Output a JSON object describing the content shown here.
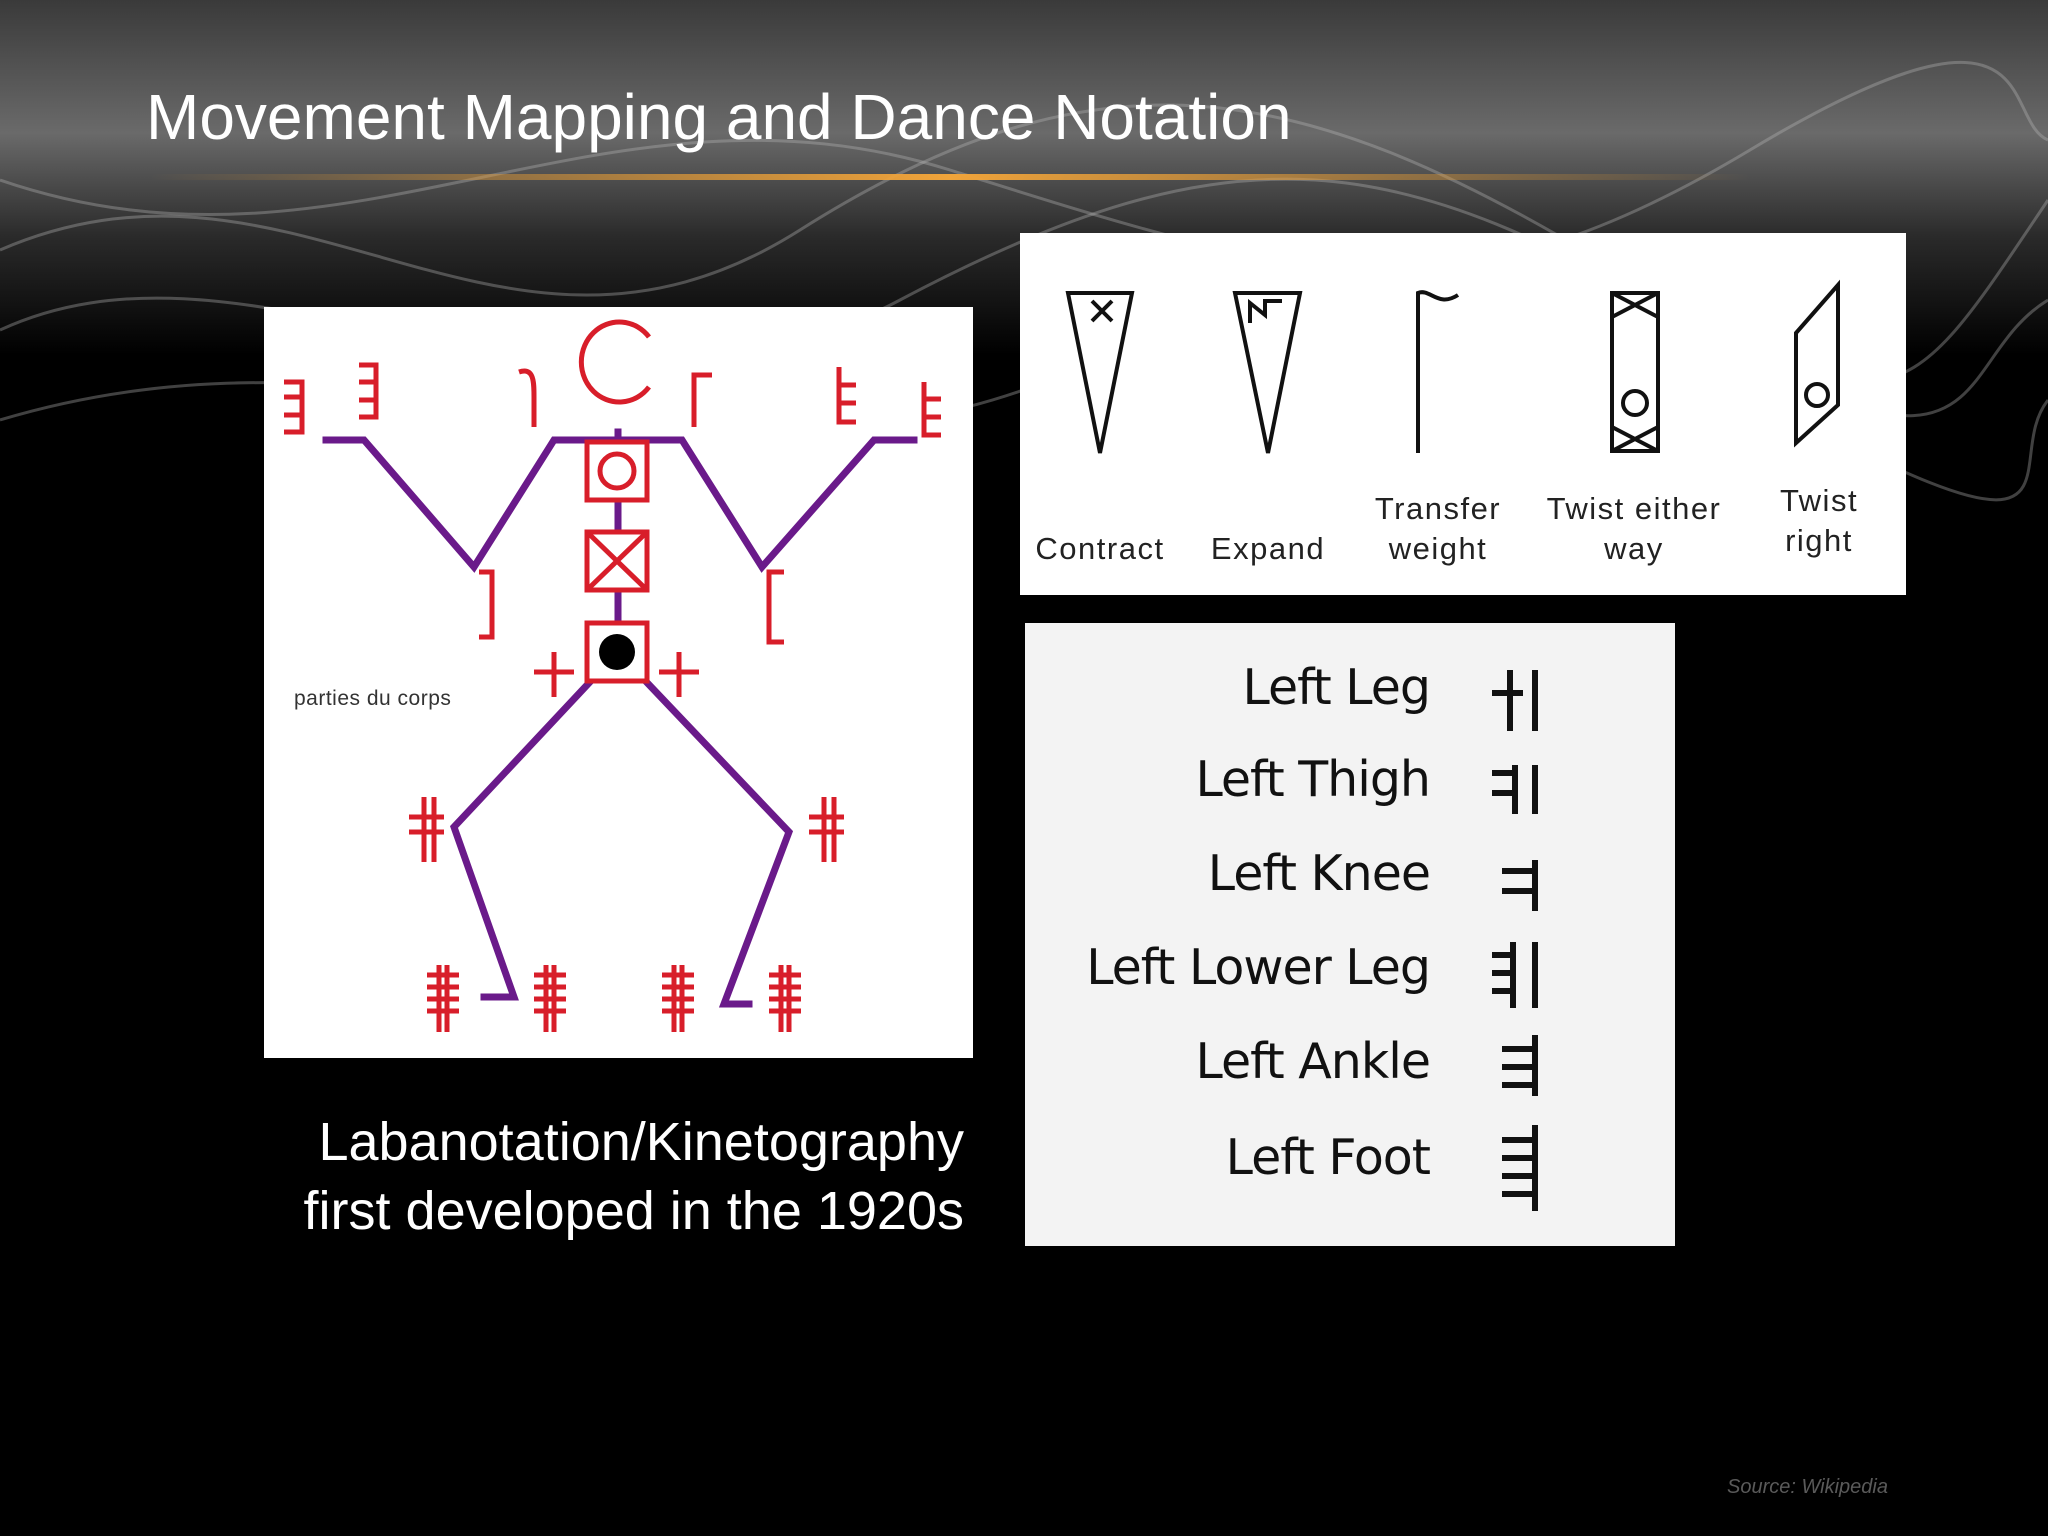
{
  "slide": {
    "title": "Movement Mapping and Dance Notation",
    "caption_line1": "Labanotation/Kinetography",
    "caption_line2": "first developed in the 1920s",
    "source": "Source: Wikipedia"
  },
  "figure": {
    "label": "parties du corps"
  },
  "actions": [
    {
      "label_line1": "Contract",
      "label_line2": ""
    },
    {
      "label_line1": "Expand",
      "label_line2": ""
    },
    {
      "label_line1": "Transfer",
      "label_line2": "weight"
    },
    {
      "label_line1": "Twist either",
      "label_line2": "way"
    },
    {
      "label_line1": "Twist",
      "label_line2": "right"
    }
  ],
  "body_parts": [
    {
      "label": "Left  Leg"
    },
    {
      "label": "Left  Thigh"
    },
    {
      "label": "Left  Knee"
    },
    {
      "label": "Left  Lower  Leg"
    },
    {
      "label": "Left  Ankle"
    },
    {
      "label": "Left  Foot"
    }
  ],
  "colors": {
    "background": "#000000",
    "accent_line": "#e79a2e",
    "symbol_red": "#d81e2a",
    "limb_purple": "#6a1a8a"
  }
}
